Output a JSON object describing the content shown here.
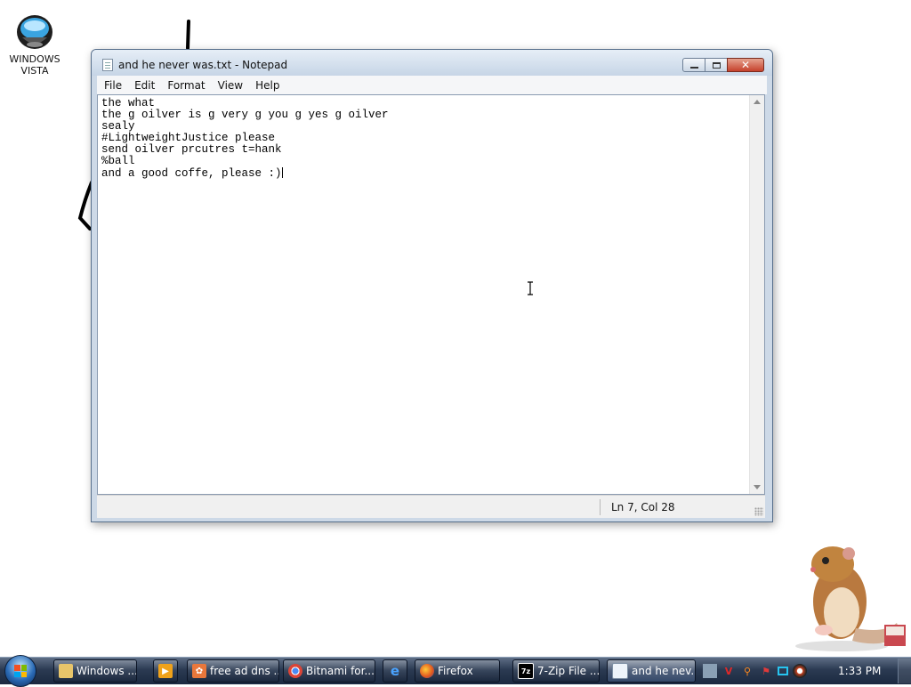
{
  "desktop": {
    "icon_label_line1": "WINDOWS",
    "icon_label_line2": "VISTA"
  },
  "window": {
    "title": "and he never was.txt - Notepad",
    "close_glyph": "✕",
    "menu": [
      "File",
      "Edit",
      "Format",
      "View",
      "Help"
    ],
    "lines": [
      "the what",
      "the g oilver is g very g you g yes g oilver",
      "sealy",
      "#LightweightJustice please",
      "send oilver prcutres t=hank",
      "%ball",
      "and a good coffe, please :)"
    ],
    "status": "Ln 7, Col 28"
  },
  "taskbar": {
    "buttons": [
      {
        "label": "Windows ...",
        "icon": "folder-icon"
      },
      {
        "label": "",
        "icon": "media-player-icon"
      },
      {
        "label": "free ad dns ...",
        "icon": "ad-icon"
      },
      {
        "label": "Bitnami for...",
        "icon": "chrome-icon"
      },
      {
        "label": "",
        "icon": "internet-explorer-icon"
      },
      {
        "label": "Firefox",
        "icon": "firefox-icon"
      },
      {
        "label": "7-Zip File ...",
        "icon": "seven-zip-icon"
      },
      {
        "label": "and he nev...",
        "icon": "notepad-icon"
      }
    ],
    "seven_zip_glyph": "7z",
    "clock": "1:33 PM"
  }
}
